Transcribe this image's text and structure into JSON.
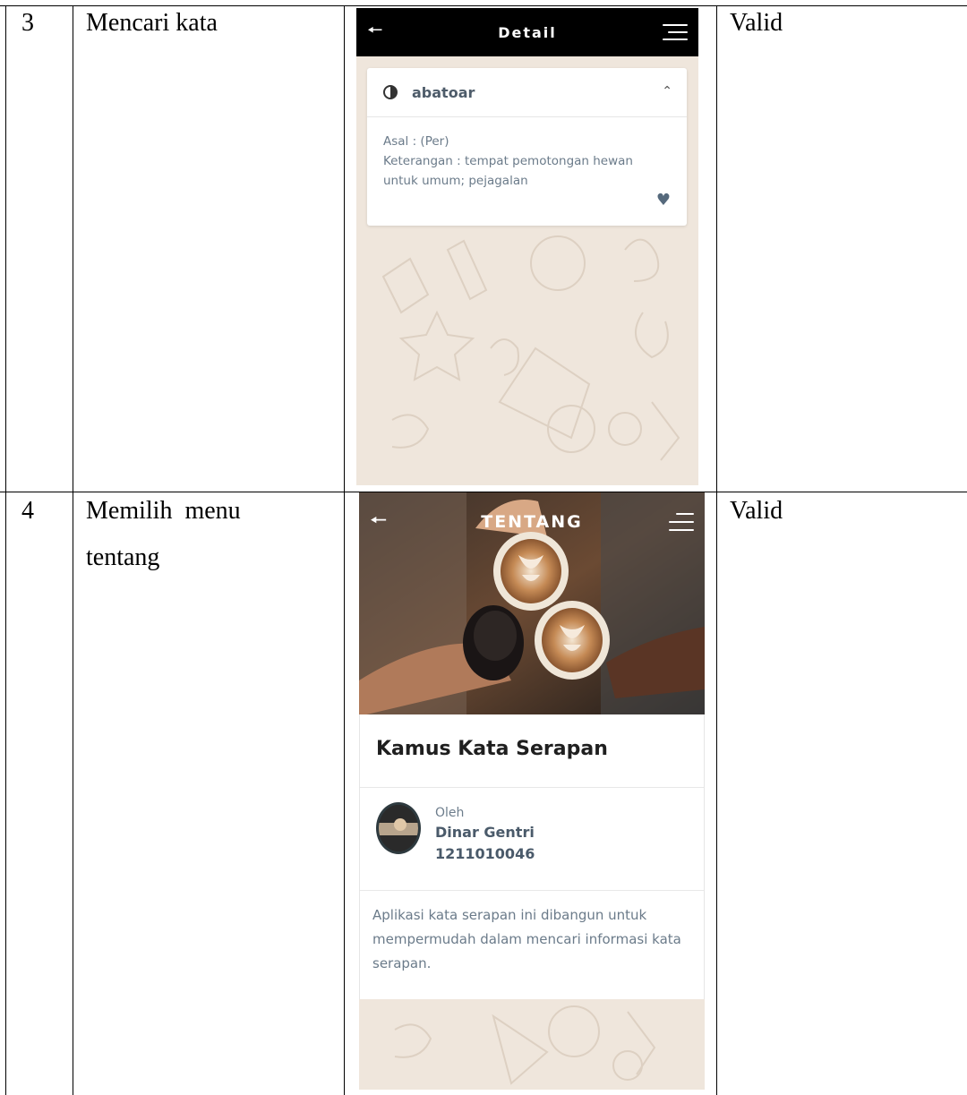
{
  "rows": [
    {
      "number": "3",
      "scenario": "Mencari kata",
      "result": "Valid",
      "screen": {
        "appbar_title": "Detail",
        "word": "abatoar",
        "origin_line": "Asal : (Per)",
        "description_line": "Keterangan : tempat pemotongan hewan untuk umum; pejagalan"
      }
    },
    {
      "number": "4",
      "scenario_line1": "Memilih  menu",
      "scenario_line2": "tentang",
      "result": "Valid",
      "screen": {
        "appbar_title": "TENTANG",
        "app_name": "Kamus Kata Serapan",
        "by_label": "Oleh",
        "author_name": "Dinar Gentri",
        "author_id": "1211010046",
        "description": "Aplikasi kata serapan ini dibangun untuk mempermudah dalam mencari informasi kata serapan."
      }
    }
  ],
  "colors": {
    "appbar_detail": "#000000",
    "doodle_background": "#efe6dc",
    "text_muted": "#6b7b8a",
    "title_dark": "#1f1f1f"
  },
  "icons": {
    "back": "arrow-left-icon",
    "menu": "hamburger-menu-icon",
    "word": "half-circle-icon",
    "collapse": "chevron-up-icon",
    "favorite": "heart-icon"
  }
}
